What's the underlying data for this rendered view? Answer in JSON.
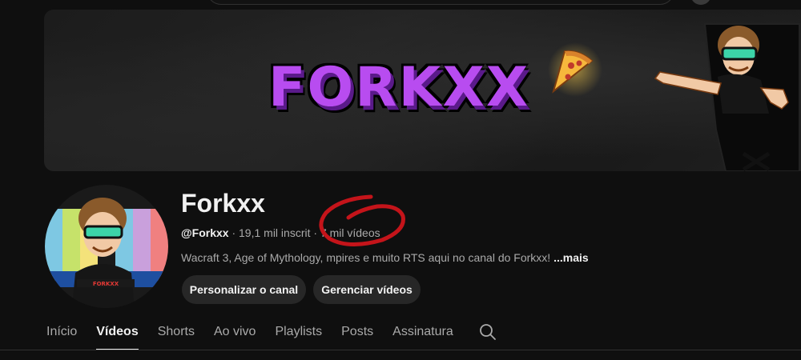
{
  "banner": {
    "logo_text": "FORKXX"
  },
  "channel": {
    "name": "Forkxx",
    "handle": "@Forkxx",
    "separator": "·",
    "subscribers": "19,1 mil inscrit",
    "videos": "7 mil vídeos",
    "description": "Wacraft 3, Age of Mythology, ",
    "description_tail": "mpires e muito RTS aqui no canal do Forkxx!",
    "more_label": "...mais",
    "avatar_badge": "FORKXX"
  },
  "buttons": {
    "customize": "Personalizar o canal",
    "manage": "Gerenciar vídeos"
  },
  "tabs": [
    {
      "label": "Início",
      "active": false
    },
    {
      "label": "Vídeos",
      "active": true
    },
    {
      "label": "Shorts",
      "active": false
    },
    {
      "label": "Ao vivo",
      "active": false
    },
    {
      "label": "Playlists",
      "active": false
    },
    {
      "label": "Posts",
      "active": false
    },
    {
      "label": "Assinatura",
      "active": false
    }
  ],
  "icons": {
    "search": "search-icon"
  },
  "colors": {
    "background": "#0f0f0f",
    "accent_purple": "#b84cf0",
    "annotation_red": "#c4141a",
    "button_bg": "#272727"
  }
}
